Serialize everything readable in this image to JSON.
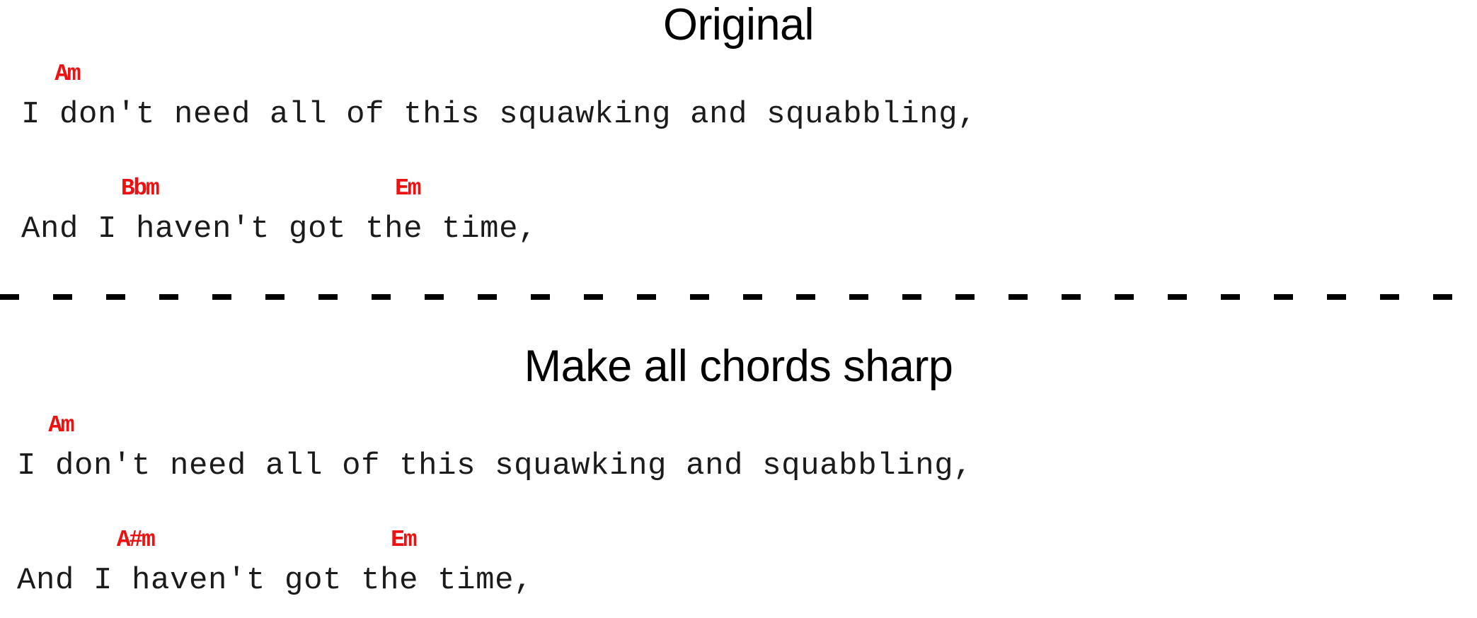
{
  "document": {
    "type": "chord-sheet-comparison",
    "background_color": "#ffffff",
    "chord_color": "#ee1111",
    "lyric_color": "#1b1b1b",
    "title_color": "#000000"
  },
  "sections": {
    "original": {
      "title": "Original",
      "chord_line_1": "  Am",
      "lyric_line_1": "I don't need all of this squawking and squabbling,",
      "chord_line_2": "        Bbm                   Em",
      "lyric_line_2": "And I haven't got the time,",
      "chords": [
        "Am",
        "Bbm",
        "Em"
      ]
    },
    "sharp": {
      "title": "Make all chords sharp",
      "chord_line_1": "  Am",
      "lyric_line_1": "I don't need all of this squawking and squabbling,",
      "chord_line_2": "        A#m                   Em",
      "lyric_line_2": "And I haven't got the time,",
      "chords": [
        "Am",
        "A#m",
        "Em"
      ]
    }
  },
  "divider": {
    "style": "dashed",
    "color": "#000000"
  }
}
